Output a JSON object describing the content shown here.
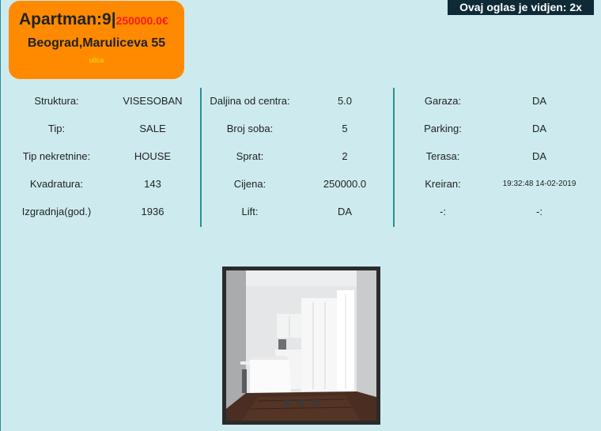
{
  "listing": {
    "title": "Apartman:9|",
    "price": "250000.0€",
    "address": "Beograd,Maruliceva 55",
    "street_tag": "ulica"
  },
  "views": {
    "label": "Ovaj oglas je vidjen: 2x"
  },
  "details": {
    "col1": [
      {
        "label": "Struktura:",
        "value": "VISESOBAN"
      },
      {
        "label": "Tip:",
        "value": "SALE"
      },
      {
        "label": "Tip nekretnine:",
        "value": "HOUSE"
      },
      {
        "label": "Kvadratura:",
        "value": "143"
      },
      {
        "label": "Izgradnja(god.)",
        "value": "1936"
      }
    ],
    "col2": [
      {
        "label": "Daljina od centra:",
        "value": "5.0"
      },
      {
        "label": "Broj soba:",
        "value": "5"
      },
      {
        "label": "Sprat:",
        "value": "2"
      },
      {
        "label": "Cijena:",
        "value": "250000.0"
      },
      {
        "label": "Lift:",
        "value": "DA"
      }
    ],
    "col3": [
      {
        "label": "Garaza:",
        "value": "DA"
      },
      {
        "label": "Parking:",
        "value": "DA"
      },
      {
        "label": "Terasa:",
        "value": "DA"
      },
      {
        "label": "Kreiran:",
        "value": "19:32:48 14-02-2019"
      },
      {
        "label": "-:",
        "value": "-:"
      }
    ]
  },
  "gallery": {
    "image": "kitchen-interior-photo",
    "slide_count": 3
  },
  "colors": {
    "background": "#cdebee",
    "card": "#ff8a00",
    "price": "#f51d1d",
    "badge": "#0d2a36",
    "divider": "#2a8f93"
  }
}
